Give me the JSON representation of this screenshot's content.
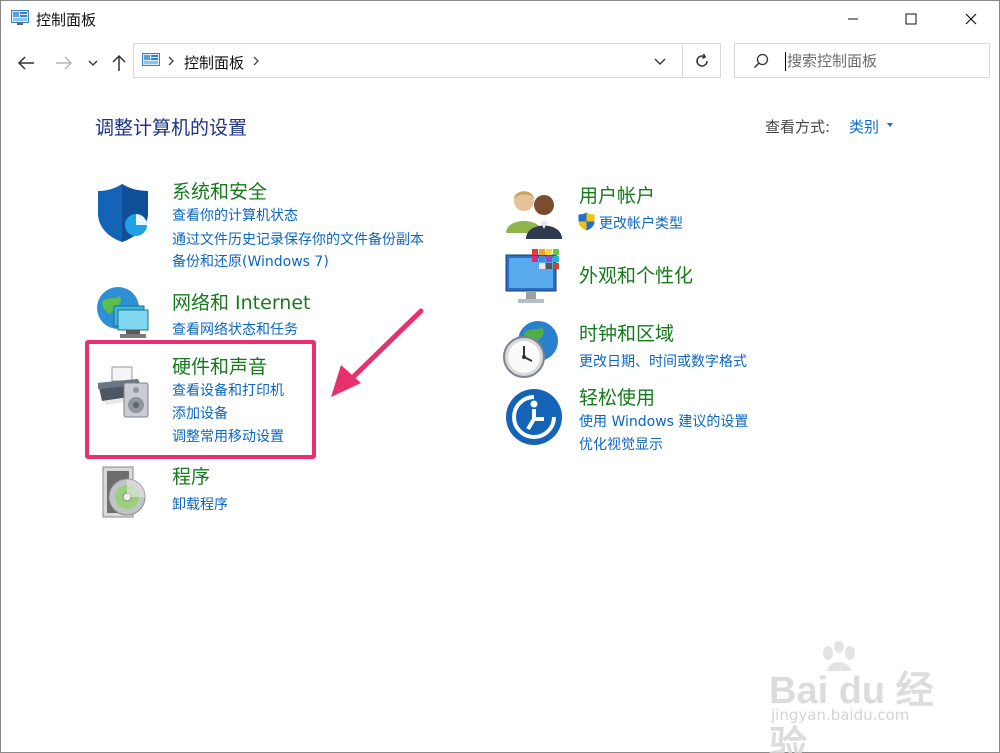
{
  "window": {
    "title": "控制面板"
  },
  "navbar": {
    "address_crumb": "控制面板",
    "search_placeholder": "搜索控制面板"
  },
  "main": {
    "title": "调整计算机的设置",
    "view_by_label": "查看方式:",
    "view_by_value": "类别"
  },
  "categories_left": [
    {
      "title": "系统和安全",
      "icon": "shield-icon",
      "links": [
        "查看你的计算机状态",
        "通过文件历史记录保存你的文件备份副本",
        "备份和还原(Windows 7)"
      ]
    },
    {
      "title": "网络和 Internet",
      "icon": "network-globe-icon",
      "links": [
        "查看网络状态和任务"
      ]
    },
    {
      "title": "硬件和声音",
      "icon": "printer-speaker-icon",
      "links": [
        "查看设备和打印机",
        "添加设备",
        "调整常用移动设置"
      ]
    },
    {
      "title": "程序",
      "icon": "programs-disc-icon",
      "links": [
        "卸载程序"
      ]
    }
  ],
  "categories_right": [
    {
      "title": "用户帐户",
      "icon": "users-icon",
      "links": [
        "更改帐户类型"
      ]
    },
    {
      "title": "外观和个性化",
      "icon": "monitor-palette-icon",
      "links": []
    },
    {
      "title": "时钟和区域",
      "icon": "clock-globe-icon",
      "links": [
        "更改日期、时间或数字格式"
      ]
    },
    {
      "title": "轻松使用",
      "icon": "ease-of-access-icon",
      "links": [
        "使用 Windows 建议的设置",
        "优化视觉显示"
      ]
    }
  ],
  "watermark": {
    "brand": "Bai du 经验",
    "url": "jingyan.baidu.com"
  },
  "colors": {
    "category_title": "#167a1d",
    "link": "#0b66c2",
    "page_title": "#1e3287",
    "highlight": "#e8306d"
  }
}
